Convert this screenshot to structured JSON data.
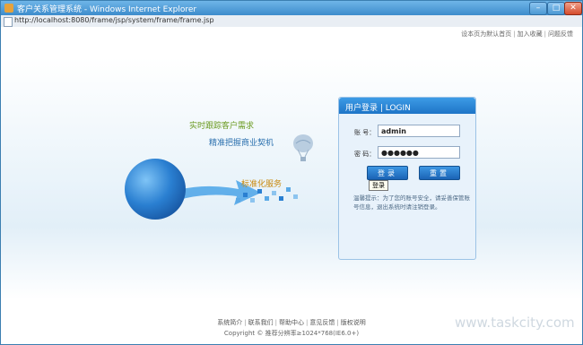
{
  "window": {
    "title": "客户关系管理系统 - Windows Internet Explorer",
    "minimize_label": "–",
    "maximize_label": "□",
    "close_label": "✕"
  },
  "address": {
    "url": "http://localhost:8080/frame/jsp/system/frame/frame.jsp"
  },
  "top_links": [
    "设本页为默认首页",
    "加入收藏",
    "问题反馈"
  ],
  "slogans": [
    "实时跟踪客户需求",
    "精准把握商业契机",
    "标准化服务"
  ],
  "login": {
    "title": "用户登录 | LOGIN",
    "username_label": "账  号：",
    "username_value": "admin",
    "password_label": "密  码：",
    "password_value": "●●●●●●",
    "login_button": "登录",
    "reset_button": "重置",
    "tooltip": "登录",
    "hint": "温馨提示：为了您的账号安全，请妥善保管账号信息，退出系统时请注销登录。"
  },
  "footer": {
    "links": [
      "系统简介",
      "联系我们",
      "帮助中心",
      "意见反馈",
      "版权说明"
    ],
    "copyright": "Copyright ©   推荐分辨率≥1024*768(IE6.0+)"
  },
  "watermark": "www.taskcity.com"
}
